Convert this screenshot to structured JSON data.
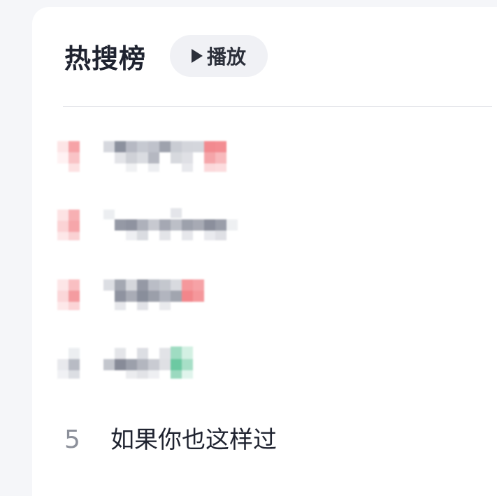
{
  "header": {
    "title": "热搜榜",
    "play_label": "播放"
  },
  "icons": {
    "play": "play-icon"
  },
  "colors": {
    "hot_red": "#f58a8f",
    "new_green": "#6cc9a2",
    "blur_gray": "#9aa0ad"
  },
  "list": [
    {
      "rank": "5",
      "text": "如果你也这样过"
    }
  ]
}
